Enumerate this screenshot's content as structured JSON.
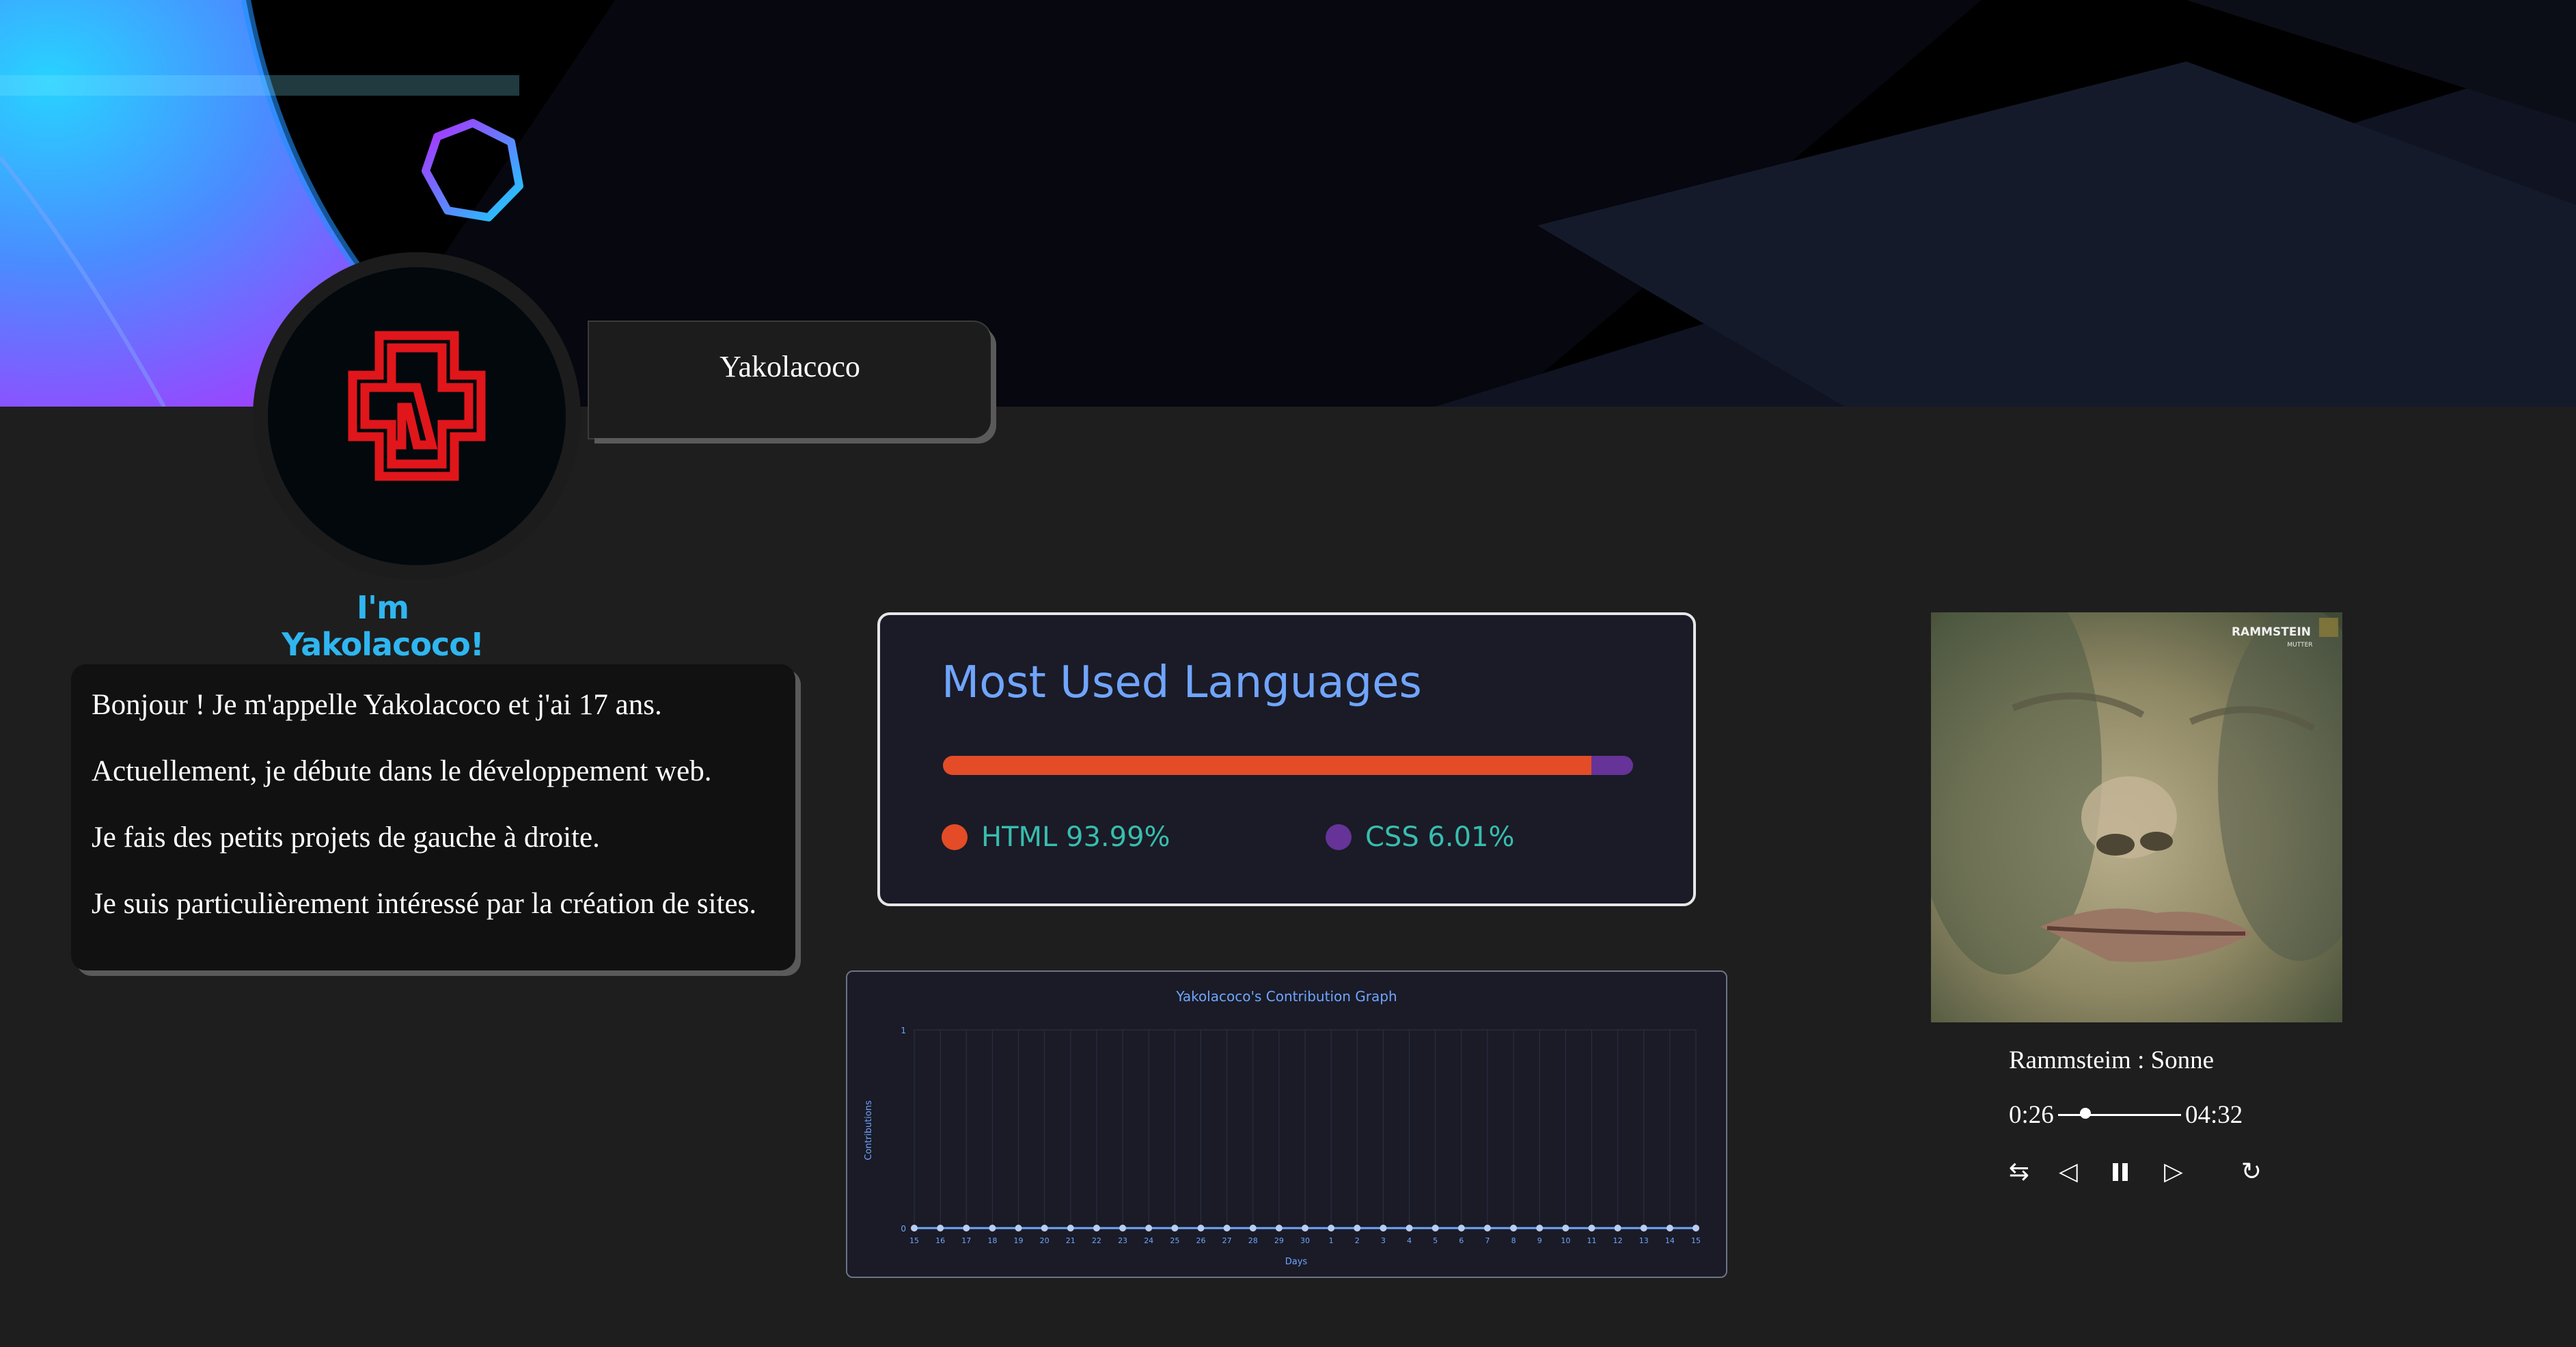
{
  "profile": {
    "username": "Yakolacoco",
    "greeting": "I'm Yakolacoco!",
    "avatar_icon": "rammstein-logo-icon"
  },
  "bio": {
    "lines": [
      "Bonjour ! Je m'appelle Yakolacoco et j'ai 17 ans.",
      "Actuellement, je débute dans le développement web.",
      "Je fais des petits projets de gauche à droite.",
      "Je suis particulièrement intéressé par la création de sites."
    ]
  },
  "languages": {
    "title": "Most Used Languages",
    "items": [
      {
        "name": "HTML",
        "percent": 93.99,
        "label": "HTML 93.99%",
        "color": "#e34c26"
      },
      {
        "name": "CSS",
        "percent": 6.01,
        "label": "CSS 6.01%",
        "color": "#663399"
      }
    ]
  },
  "chart_data": {
    "type": "line",
    "title": "Yakolacoco's Contribution Graph",
    "xlabel": "Days",
    "ylabel": "Contributions",
    "x": [
      "15",
      "16",
      "17",
      "18",
      "19",
      "20",
      "21",
      "22",
      "23",
      "24",
      "25",
      "26",
      "27",
      "28",
      "29",
      "30",
      "1",
      "2",
      "3",
      "4",
      "5",
      "6",
      "7",
      "8",
      "9",
      "10",
      "11",
      "12",
      "13",
      "14",
      "15"
    ],
    "values": [
      0,
      0,
      0,
      0,
      0,
      0,
      0,
      0,
      0,
      0,
      0,
      0,
      0,
      0,
      0,
      0,
      0,
      0,
      0,
      0,
      0,
      0,
      0,
      0,
      0,
      0,
      0,
      0,
      0,
      0,
      0
    ],
    "y_ticks": [
      "0",
      "1"
    ],
    "ylim": [
      0,
      1
    ],
    "grid": true,
    "color": "#70a5fd"
  },
  "player": {
    "song": "Rammsteim : Sonne",
    "current_time": "0:26",
    "duration": "04:32",
    "progress": 0.096,
    "cover_text": "RAMMSTEIN",
    "cover_subtext": "MUTTER",
    "controls": {
      "shuffle_icon": "⇆",
      "prev_icon": "◁",
      "pause_icon": "⏸",
      "next_icon": "▷",
      "repeat_icon": "↻"
    }
  }
}
